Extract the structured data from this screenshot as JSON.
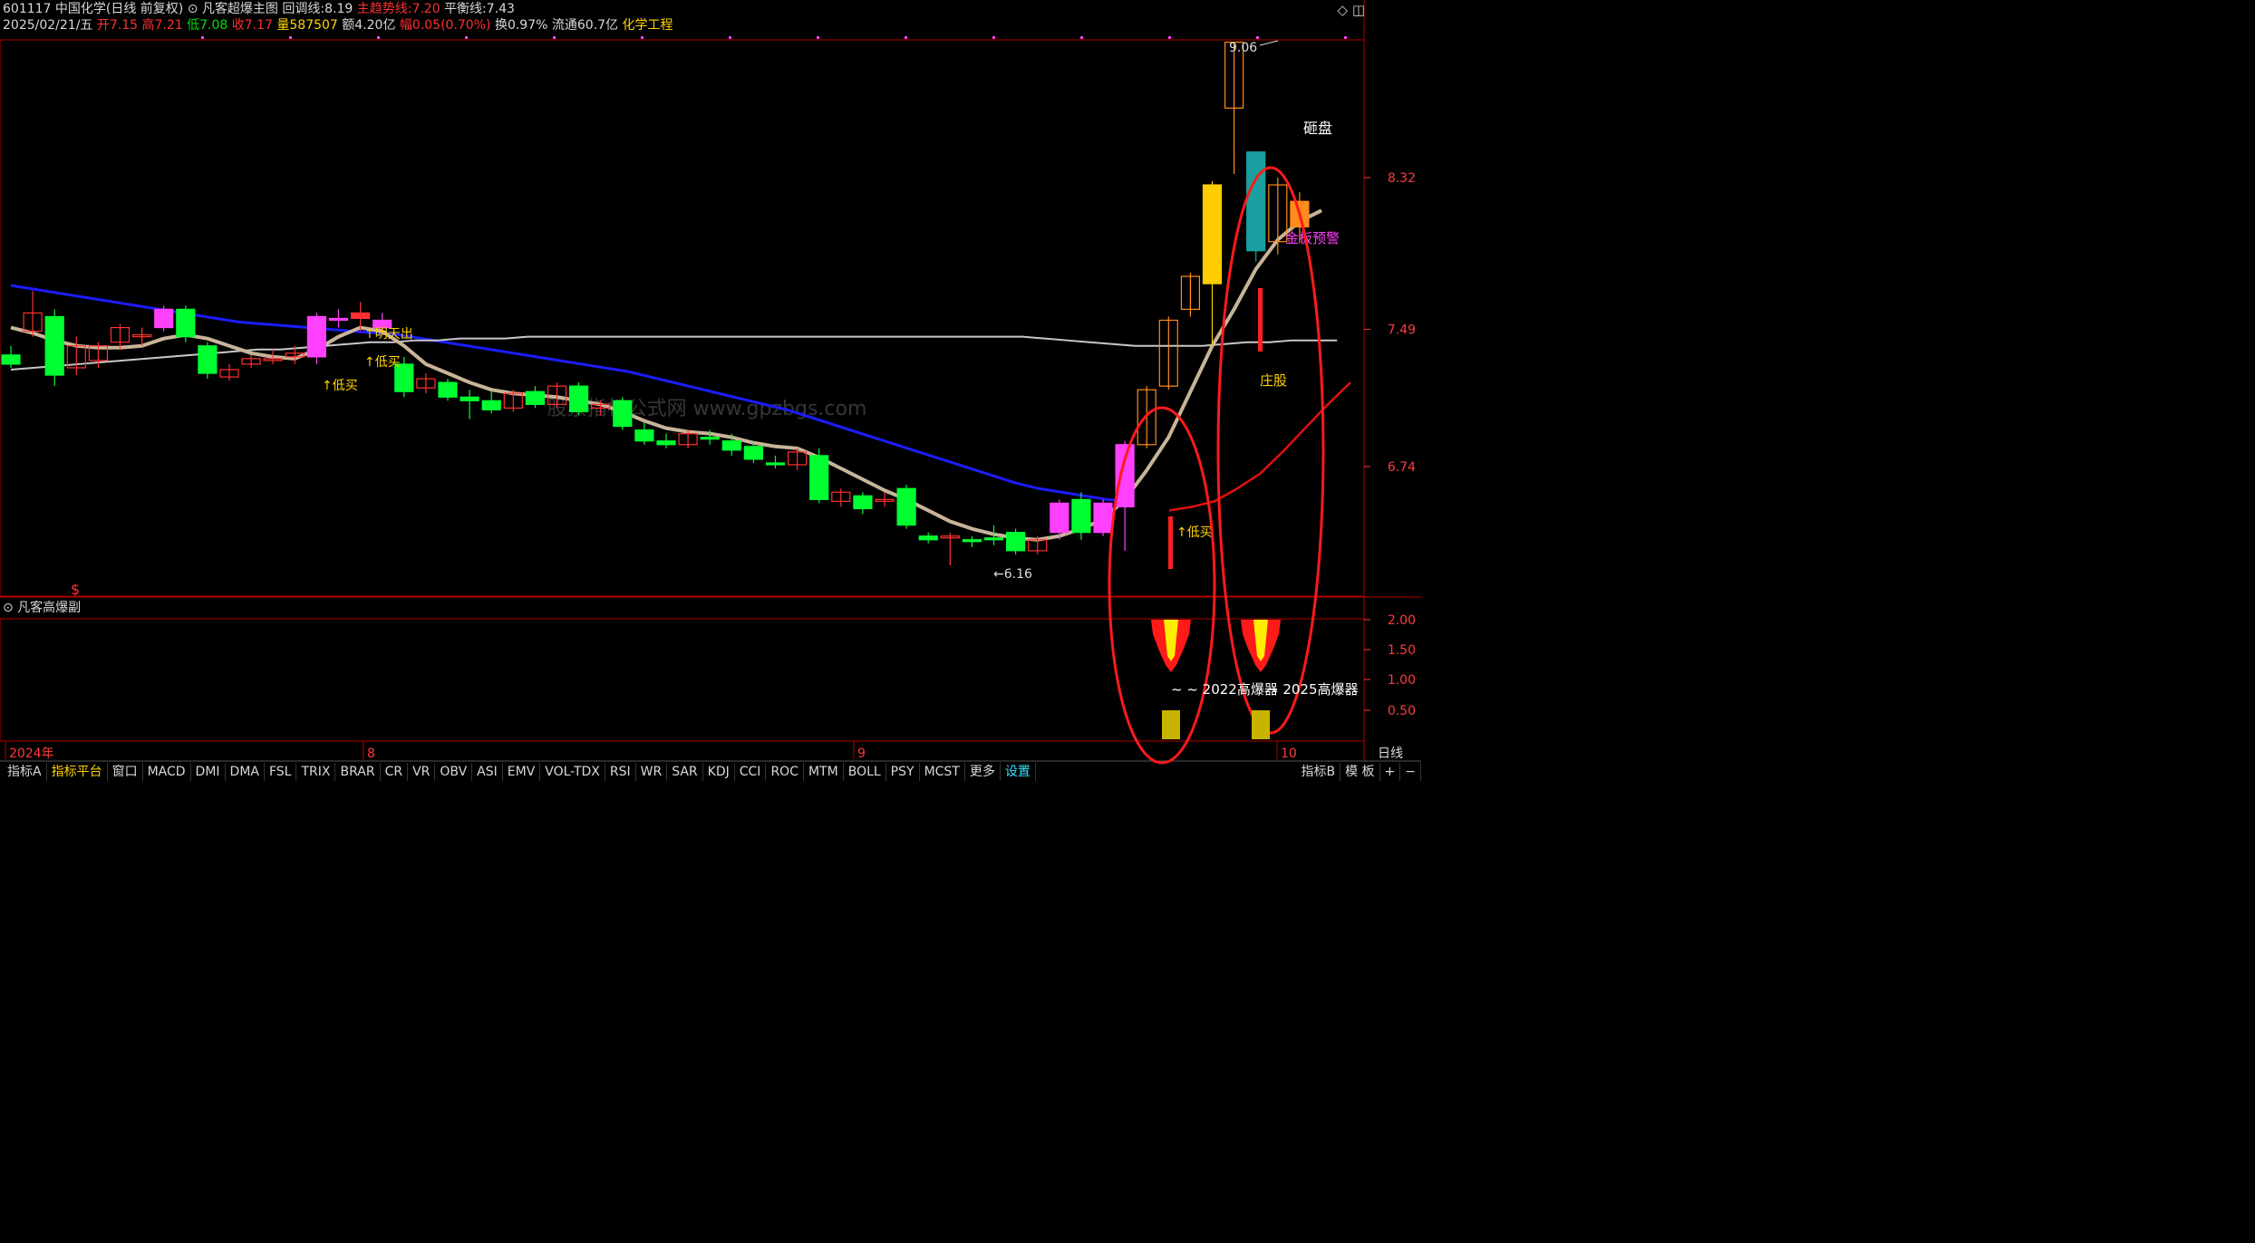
{
  "header": {
    "code_name": "601117 中国化学(日线 前复权)",
    "indicator": "凡客超爆主图",
    "pullback_label": "回调线:",
    "pullback_value": "8.19",
    "trend_label": "主趋势线:",
    "trend_value": "7.20",
    "balance_label": "平衡线:",
    "balance_value": "7.43",
    "date": "2025/02/21/五",
    "open_label": "开",
    "open": "7.15",
    "high_label": "高",
    "high": "7.21",
    "low_label": "低",
    "low": "7.08",
    "close_label": "收",
    "close": "7.17",
    "vol_label": "量",
    "vol": "587507",
    "amount_label": "额",
    "amount": "4.20亿",
    "change_label": "幅",
    "change": "0.05(0.70%)",
    "turnover_label": "换",
    "turnover": "0.97%",
    "float_label": "流通",
    "float": "60.7亿",
    "sector": "化学工程"
  },
  "window_controls": {
    "diamond": "◇",
    "restore": "◫"
  },
  "price_axis": [
    "8.32",
    "7.49",
    "6.74"
  ],
  "sub_axis": [
    "2.00",
    "1.50",
    "1.00",
    "0.50"
  ],
  "date_axis": [
    "2024年",
    "8",
    "9",
    "10"
  ],
  "sub_pane_label": "凡客高爆副",
  "signals": {
    "low_buy": "低买",
    "tomorrow_out": "明天出",
    "high_label": "9.06",
    "low_label": "6.16",
    "smash": "砸盘",
    "limit_up": "金板预警",
    "dealer": "庄股",
    "explosive1": "~ ~ 2022高爆器",
    "explosive2": "~ 2025高爆器",
    "dollar": "$",
    "arrow_up": "↑",
    "arrow_left": "←"
  },
  "watermark": "股票指标公式网 www.gpzbgs.com",
  "tabs": [
    "指标A",
    "指标平台",
    "窗口",
    "MACD",
    "DMI",
    "DMA",
    "FSL",
    "TRIX",
    "BRAR",
    "CR",
    "VR",
    "OBV",
    "ASI",
    "EMV",
    "VOL-TDX",
    "RSI",
    "WR",
    "SAR",
    "KDJ",
    "CCI",
    "ROC",
    "MTM",
    "BOLL",
    "PSY",
    "MCST",
    "更多",
    "设置"
  ],
  "right_tabs": [
    "指标B",
    "模 板",
    "+",
    "−"
  ],
  "period": "日线",
  "colors": {
    "up": "#ff3030",
    "down": "#00ff30",
    "blue_line": "#1c1cff",
    "trend": "#c8b498",
    "balance": "#c8c8c8",
    "red_line": "#e01010",
    "border": "#b00000"
  },
  "chart_data": {
    "type": "candlestick",
    "price_ticks": [
      8.32,
      7.49,
      6.74
    ],
    "candles": [
      {
        "o": 7.35,
        "h": 7.4,
        "l": 7.28,
        "c": 7.3,
        "col": "down"
      },
      {
        "o": 7.48,
        "h": 7.7,
        "l": 7.45,
        "c": 7.58,
        "col": "up"
      },
      {
        "o": 7.56,
        "h": 7.6,
        "l": 7.18,
        "c": 7.24,
        "col": "down"
      },
      {
        "o": 7.4,
        "h": 7.45,
        "l": 7.24,
        "c": 7.28,
        "col": "up"
      },
      {
        "o": 7.32,
        "h": 7.42,
        "l": 7.28,
        "c": 7.4,
        "col": "up"
      },
      {
        "o": 7.42,
        "h": 7.52,
        "l": 7.38,
        "c": 7.5,
        "col": "up"
      },
      {
        "o": 7.46,
        "h": 7.5,
        "l": 7.4,
        "c": 7.45,
        "col": "up"
      },
      {
        "o": 7.5,
        "h": 7.62,
        "l": 7.48,
        "c": 7.6,
        "col": "magenta"
      },
      {
        "o": 7.6,
        "h": 7.62,
        "l": 7.42,
        "c": 7.45,
        "col": "down"
      },
      {
        "o": 7.4,
        "h": 7.42,
        "l": 7.22,
        "c": 7.25,
        "col": "down"
      },
      {
        "o": 7.27,
        "h": 7.3,
        "l": 7.21,
        "c": 7.23,
        "col": "up"
      },
      {
        "o": 7.3,
        "h": 7.35,
        "l": 7.28,
        "c": 7.33,
        "col": "up"
      },
      {
        "o": 7.33,
        "h": 7.38,
        "l": 7.3,
        "c": 7.32,
        "col": "up"
      },
      {
        "o": 7.34,
        "h": 7.4,
        "l": 7.3,
        "c": 7.36,
        "col": "up"
      },
      {
        "o": 7.34,
        "h": 7.58,
        "l": 7.3,
        "c": 7.56,
        "col": "magenta"
      },
      {
        "o": 7.55,
        "h": 7.6,
        "l": 7.5,
        "c": 7.55,
        "col": "magenta"
      },
      {
        "o": 7.55,
        "h": 7.64,
        "l": 7.48,
        "c": 7.58,
        "col": "red"
      },
      {
        "o": 7.54,
        "h": 7.58,
        "l": 7.48,
        "c": 7.5,
        "col": "magenta"
      },
      {
        "o": 7.3,
        "h": 7.34,
        "l": 7.12,
        "c": 7.15,
        "col": "down"
      },
      {
        "o": 7.17,
        "h": 7.25,
        "l": 7.14,
        "c": 7.22,
        "col": "up"
      },
      {
        "o": 7.2,
        "h": 7.22,
        "l": 7.1,
        "c": 7.12,
        "col": "down"
      },
      {
        "o": 7.12,
        "h": 7.16,
        "l": 7.0,
        "c": 7.1,
        "col": "down"
      },
      {
        "o": 7.1,
        "h": 7.15,
        "l": 7.03,
        "c": 7.05,
        "col": "down"
      },
      {
        "o": 7.06,
        "h": 7.16,
        "l": 7.04,
        "c": 7.14,
        "col": "up"
      },
      {
        "o": 7.15,
        "h": 7.18,
        "l": 7.06,
        "c": 7.08,
        "col": "down"
      },
      {
        "o": 7.08,
        "h": 7.2,
        "l": 7.06,
        "c": 7.18,
        "col": "up"
      },
      {
        "o": 7.18,
        "h": 7.2,
        "l": 7.02,
        "c": 7.04,
        "col": "down"
      },
      {
        "o": 7.06,
        "h": 7.1,
        "l": 7.02,
        "c": 7.08,
        "col": "up"
      },
      {
        "o": 7.1,
        "h": 7.12,
        "l": 6.94,
        "c": 6.96,
        "col": "down"
      },
      {
        "o": 6.94,
        "h": 6.98,
        "l": 6.86,
        "c": 6.88,
        "col": "down"
      },
      {
        "o": 6.88,
        "h": 6.92,
        "l": 6.84,
        "c": 6.86,
        "col": "down"
      },
      {
        "o": 6.86,
        "h": 6.94,
        "l": 6.84,
        "c": 6.92,
        "col": "up"
      },
      {
        "o": 6.9,
        "h": 6.94,
        "l": 6.86,
        "c": 6.89,
        "col": "down"
      },
      {
        "o": 6.88,
        "h": 6.92,
        "l": 6.8,
        "c": 6.83,
        "col": "down"
      },
      {
        "o": 6.85,
        "h": 6.88,
        "l": 6.76,
        "c": 6.78,
        "col": "down"
      },
      {
        "o": 6.76,
        "h": 6.8,
        "l": 6.73,
        "c": 6.75,
        "col": "down"
      },
      {
        "o": 6.75,
        "h": 6.84,
        "l": 6.72,
        "c": 6.82,
        "col": "up"
      },
      {
        "o": 6.8,
        "h": 6.84,
        "l": 6.54,
        "c": 6.56,
        "col": "down"
      },
      {
        "o": 6.55,
        "h": 6.62,
        "l": 6.52,
        "c": 6.6,
        "col": "up"
      },
      {
        "o": 6.58,
        "h": 6.6,
        "l": 6.48,
        "c": 6.51,
        "col": "down"
      },
      {
        "o": 6.56,
        "h": 6.6,
        "l": 6.52,
        "c": 6.56,
        "col": "up"
      },
      {
        "o": 6.62,
        "h": 6.64,
        "l": 6.4,
        "c": 6.42,
        "col": "down"
      },
      {
        "o": 6.36,
        "h": 6.38,
        "l": 6.32,
        "c": 6.34,
        "col": "down"
      },
      {
        "o": 6.35,
        "h": 6.38,
        "l": 6.2,
        "c": 6.36,
        "col": "up"
      },
      {
        "o": 6.34,
        "h": 6.36,
        "l": 6.3,
        "c": 6.33,
        "col": "down"
      },
      {
        "o": 6.35,
        "h": 6.42,
        "l": 6.31,
        "c": 6.34,
        "col": "down"
      },
      {
        "o": 6.38,
        "h": 6.4,
        "l": 6.26,
        "c": 6.28,
        "col": "down"
      },
      {
        "o": 6.28,
        "h": 6.36,
        "l": 6.26,
        "c": 6.34,
        "col": "up"
      },
      {
        "o": 6.38,
        "h": 6.56,
        "l": 6.34,
        "c": 6.54,
        "col": "magenta"
      },
      {
        "o": 6.56,
        "h": 6.6,
        "l": 6.34,
        "c": 6.38,
        "col": "down"
      },
      {
        "o": 6.38,
        "h": 6.56,
        "l": 6.36,
        "c": 6.54,
        "col": "magenta"
      },
      {
        "o": 6.52,
        "h": 6.88,
        "l": 6.28,
        "c": 6.86,
        "col": "magenta"
      },
      {
        "o": 6.86,
        "h": 7.18,
        "l": 6.84,
        "c": 7.16,
        "col": "orange"
      },
      {
        "o": 7.18,
        "h": 7.56,
        "l": 7.16,
        "c": 7.54,
        "col": "orange"
      },
      {
        "o": 7.6,
        "h": 7.8,
        "l": 7.56,
        "c": 7.78,
        "col": "orange"
      },
      {
        "o": 7.74,
        "h": 8.3,
        "l": 7.4,
        "c": 8.28,
        "col": "gold"
      },
      {
        "o": 8.7,
        "h": 9.06,
        "l": 8.34,
        "c": 9.06,
        "col": "orange"
      },
      {
        "o": 8.46,
        "h": 8.46,
        "l": 7.86,
        "c": 7.92,
        "col": "teal"
      },
      {
        "o": 7.97,
        "h": 8.32,
        "l": 7.9,
        "c": 8.28,
        "col": "orange"
      },
      {
        "o": 8.19,
        "h": 8.24,
        "l": 7.96,
        "c": 8.05,
        "col": "orangefill"
      }
    ],
    "trend_line": [
      7.5,
      7.47,
      7.43,
      7.4,
      7.39,
      7.39,
      7.4,
      7.44,
      7.46,
      7.44,
      7.4,
      7.36,
      7.34,
      7.33,
      7.38,
      7.45,
      7.5,
      7.48,
      7.4,
      7.3,
      7.25,
      7.2,
      7.16,
      7.14,
      7.13,
      7.12,
      7.1,
      7.08,
      7.04,
      6.99,
      6.95,
      6.93,
      6.92,
      6.9,
      6.87,
      6.85,
      6.84,
      6.79,
      6.73,
      6.67,
      6.61,
      6.56,
      6.5,
      6.44,
      6.4,
      6.37,
      6.35,
      6.34,
      6.36,
      6.4,
      6.45,
      6.56,
      6.72,
      6.9,
      7.15,
      7.4,
      7.6,
      7.82,
      7.98,
      8.08,
      8.14
    ],
    "blue_line": [
      7.73,
      7.71,
      7.69,
      7.67,
      7.65,
      7.63,
      7.61,
      7.59,
      7.57,
      7.55,
      7.53,
      7.52,
      7.51,
      7.5,
      7.49,
      7.48,
      7.47,
      7.46,
      7.44,
      7.42,
      7.4,
      7.38,
      7.36,
      7.34,
      7.32,
      7.3,
      7.28,
      7.26,
      7.23,
      7.2,
      7.17,
      7.14,
      7.11,
      7.08,
      7.05,
      7.01,
      6.97,
      6.93,
      6.89,
      6.85,
      6.81,
      6.77,
      6.73,
      6.69,
      6.65,
      6.62,
      6.6,
      6.58,
      6.56,
      6.55
    ],
    "balance_line": [
      7.27,
      7.28,
      7.29,
      7.3,
      7.31,
      7.32,
      7.33,
      7.34,
      7.35,
      7.36,
      7.37,
      7.38,
      7.38,
      7.39,
      7.4,
      7.41,
      7.42,
      7.42,
      7.43,
      7.43,
      7.44,
      7.44,
      7.44,
      7.45,
      7.45,
      7.45,
      7.45,
      7.45,
      7.45,
      7.45,
      7.45,
      7.45,
      7.45,
      7.45,
      7.45,
      7.45,
      7.45,
      7.45,
      7.45,
      7.45,
      7.45,
      7.45,
      7.45,
      7.45,
      7.45,
      7.45,
      7.44,
      7.43,
      7.42,
      7.41,
      7.4,
      7.4,
      7.4,
      7.4,
      7.41,
      7.42,
      7.42,
      7.43,
      7.43,
      7.43
    ],
    "red_line": [
      6.5,
      6.52,
      6.55,
      6.62,
      6.7,
      6.82,
      6.95,
      7.08,
      7.2
    ]
  }
}
